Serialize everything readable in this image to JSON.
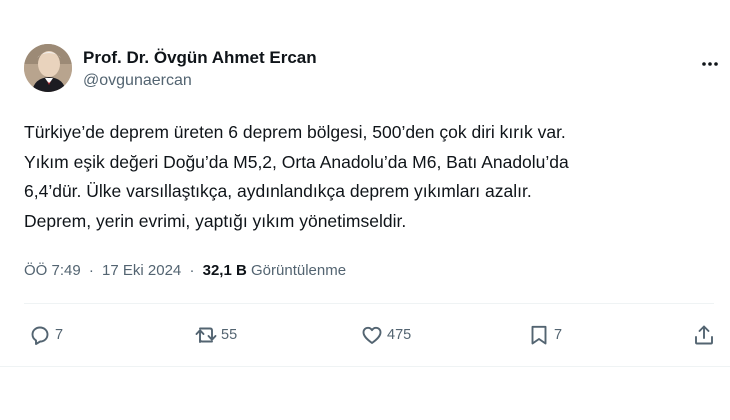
{
  "author": {
    "display_name": "Prof. Dr. Övgün Ahmet Ercan",
    "handle": "@ovgunaercan"
  },
  "tweet": {
    "text": "Türkiye’de deprem üreten 6 deprem bölgesi, 500’den çok diri kırık var.\nYıkım eşik değeri Doğu’da M5,2, Orta Anadolu’da M6, Batı Anadolu’da\n6,4’dür. Ülke varsıllaştıkça, aydınlandıkça deprem yıkımları azalır.\nDeprem, yerin evrimi, yaptığı yıkım yönetimseldir."
  },
  "meta": {
    "time": "ÖÖ 7:49",
    "separator": "·",
    "date": "17 Eki 2024",
    "views_count": "32,1 B",
    "views_label": "Görüntülenme"
  },
  "actions": {
    "replies": "7",
    "reposts": "55",
    "likes": "475",
    "bookmarks": "7"
  },
  "icons": {
    "more": "more-horizontal-icon",
    "reply": "reply-icon",
    "repost": "repost-icon",
    "like": "heart-icon",
    "bookmark": "bookmark-icon",
    "share": "share-icon"
  },
  "colors": {
    "text_primary": "#0f1419",
    "text_secondary": "#536471",
    "divider": "#eff3f4"
  }
}
